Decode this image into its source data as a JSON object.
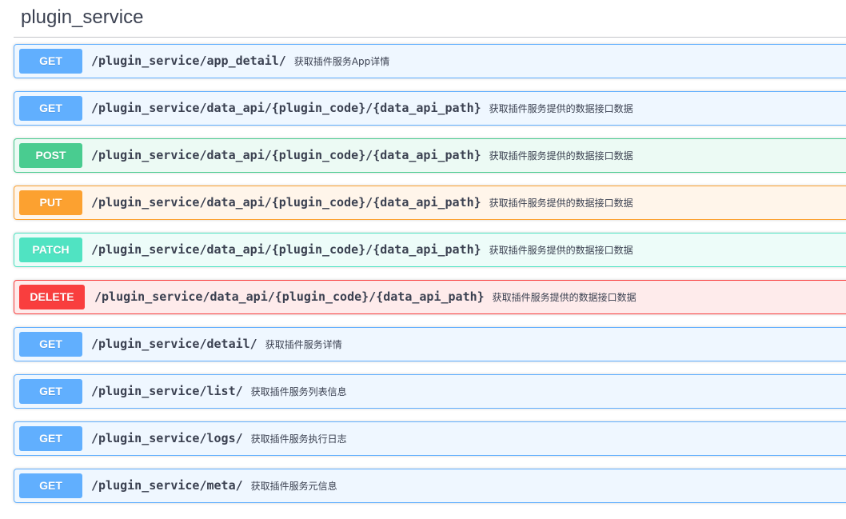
{
  "tag": {
    "title": "plugin_service"
  },
  "colors": {
    "get": "#61affe",
    "post": "#49cc90",
    "put": "#fca130",
    "patch": "#50e3c2",
    "delete": "#f93e3e"
  },
  "operations": [
    {
      "method": "GET",
      "path": "/plugin_service/app_detail/",
      "summary": "获取插件服务App详情"
    },
    {
      "method": "GET",
      "path": "/plugin_service/data_api/{plugin_code}/{data_api_path}",
      "summary": "获取插件服务提供的数据接口数据"
    },
    {
      "method": "POST",
      "path": "/plugin_service/data_api/{plugin_code}/{data_api_path}",
      "summary": "获取插件服务提供的数据接口数据"
    },
    {
      "method": "PUT",
      "path": "/plugin_service/data_api/{plugin_code}/{data_api_path}",
      "summary": "获取插件服务提供的数据接口数据"
    },
    {
      "method": "PATCH",
      "path": "/plugin_service/data_api/{plugin_code}/{data_api_path}",
      "summary": "获取插件服务提供的数据接口数据"
    },
    {
      "method": "DELETE",
      "path": "/plugin_service/data_api/{plugin_code}/{data_api_path}",
      "summary": "获取插件服务提供的数据接口数据"
    },
    {
      "method": "GET",
      "path": "/plugin_service/detail/",
      "summary": "获取插件服务详情"
    },
    {
      "method": "GET",
      "path": "/plugin_service/list/",
      "summary": "获取插件服务列表信息"
    },
    {
      "method": "GET",
      "path": "/plugin_service/logs/",
      "summary": "获取插件服务执行日志"
    },
    {
      "method": "GET",
      "path": "/plugin_service/meta/",
      "summary": "获取插件服务元信息"
    }
  ]
}
